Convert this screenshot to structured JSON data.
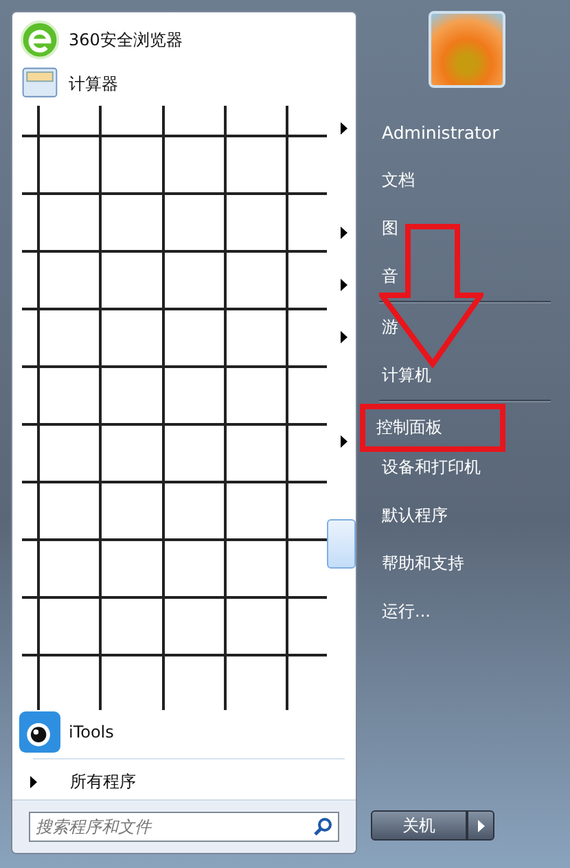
{
  "pinned_programs": [
    {
      "label": "360安全浏览器",
      "kind": "browser"
    },
    {
      "label": "计算器",
      "kind": "calculator"
    }
  ],
  "hidden_rows": [
    {
      "submenu": true,
      "selected": false
    },
    {
      "submenu": false,
      "selected": false
    },
    {
      "submenu": true,
      "selected": false
    },
    {
      "submenu": true,
      "selected": false
    },
    {
      "submenu": true,
      "selected": false
    },
    {
      "submenu": false,
      "selected": false
    },
    {
      "submenu": true,
      "selected": false
    },
    {
      "submenu": false,
      "selected": false
    },
    {
      "submenu": false,
      "selected": true
    },
    {
      "submenu": false,
      "selected": false
    },
    {
      "submenu": false,
      "selected": false
    }
  ],
  "recent_programs": [
    {
      "label": "iTools",
      "kind": "itools"
    }
  ],
  "all_programs": "所有程序",
  "search": {
    "placeholder": "搜索程序和文件"
  },
  "user": {
    "name": "Administrator"
  },
  "places": [
    {
      "label": "文档",
      "separator_after": false
    },
    {
      "label": "图",
      "separator_after": false
    },
    {
      "label": "音",
      "separator_after": true
    },
    {
      "label": "游",
      "separator_after": false
    },
    {
      "label": "计算机",
      "separator_after": true
    },
    {
      "label": "控制面板",
      "separator_after": false,
      "annotated": true
    },
    {
      "label": "设备和打印机",
      "separator_after": false
    },
    {
      "label": "默认程序",
      "separator_after": false
    },
    {
      "label": "帮助和支持",
      "separator_after": false
    },
    {
      "label": "运行...",
      "separator_after": false
    }
  ],
  "shutdown_button": "关机"
}
